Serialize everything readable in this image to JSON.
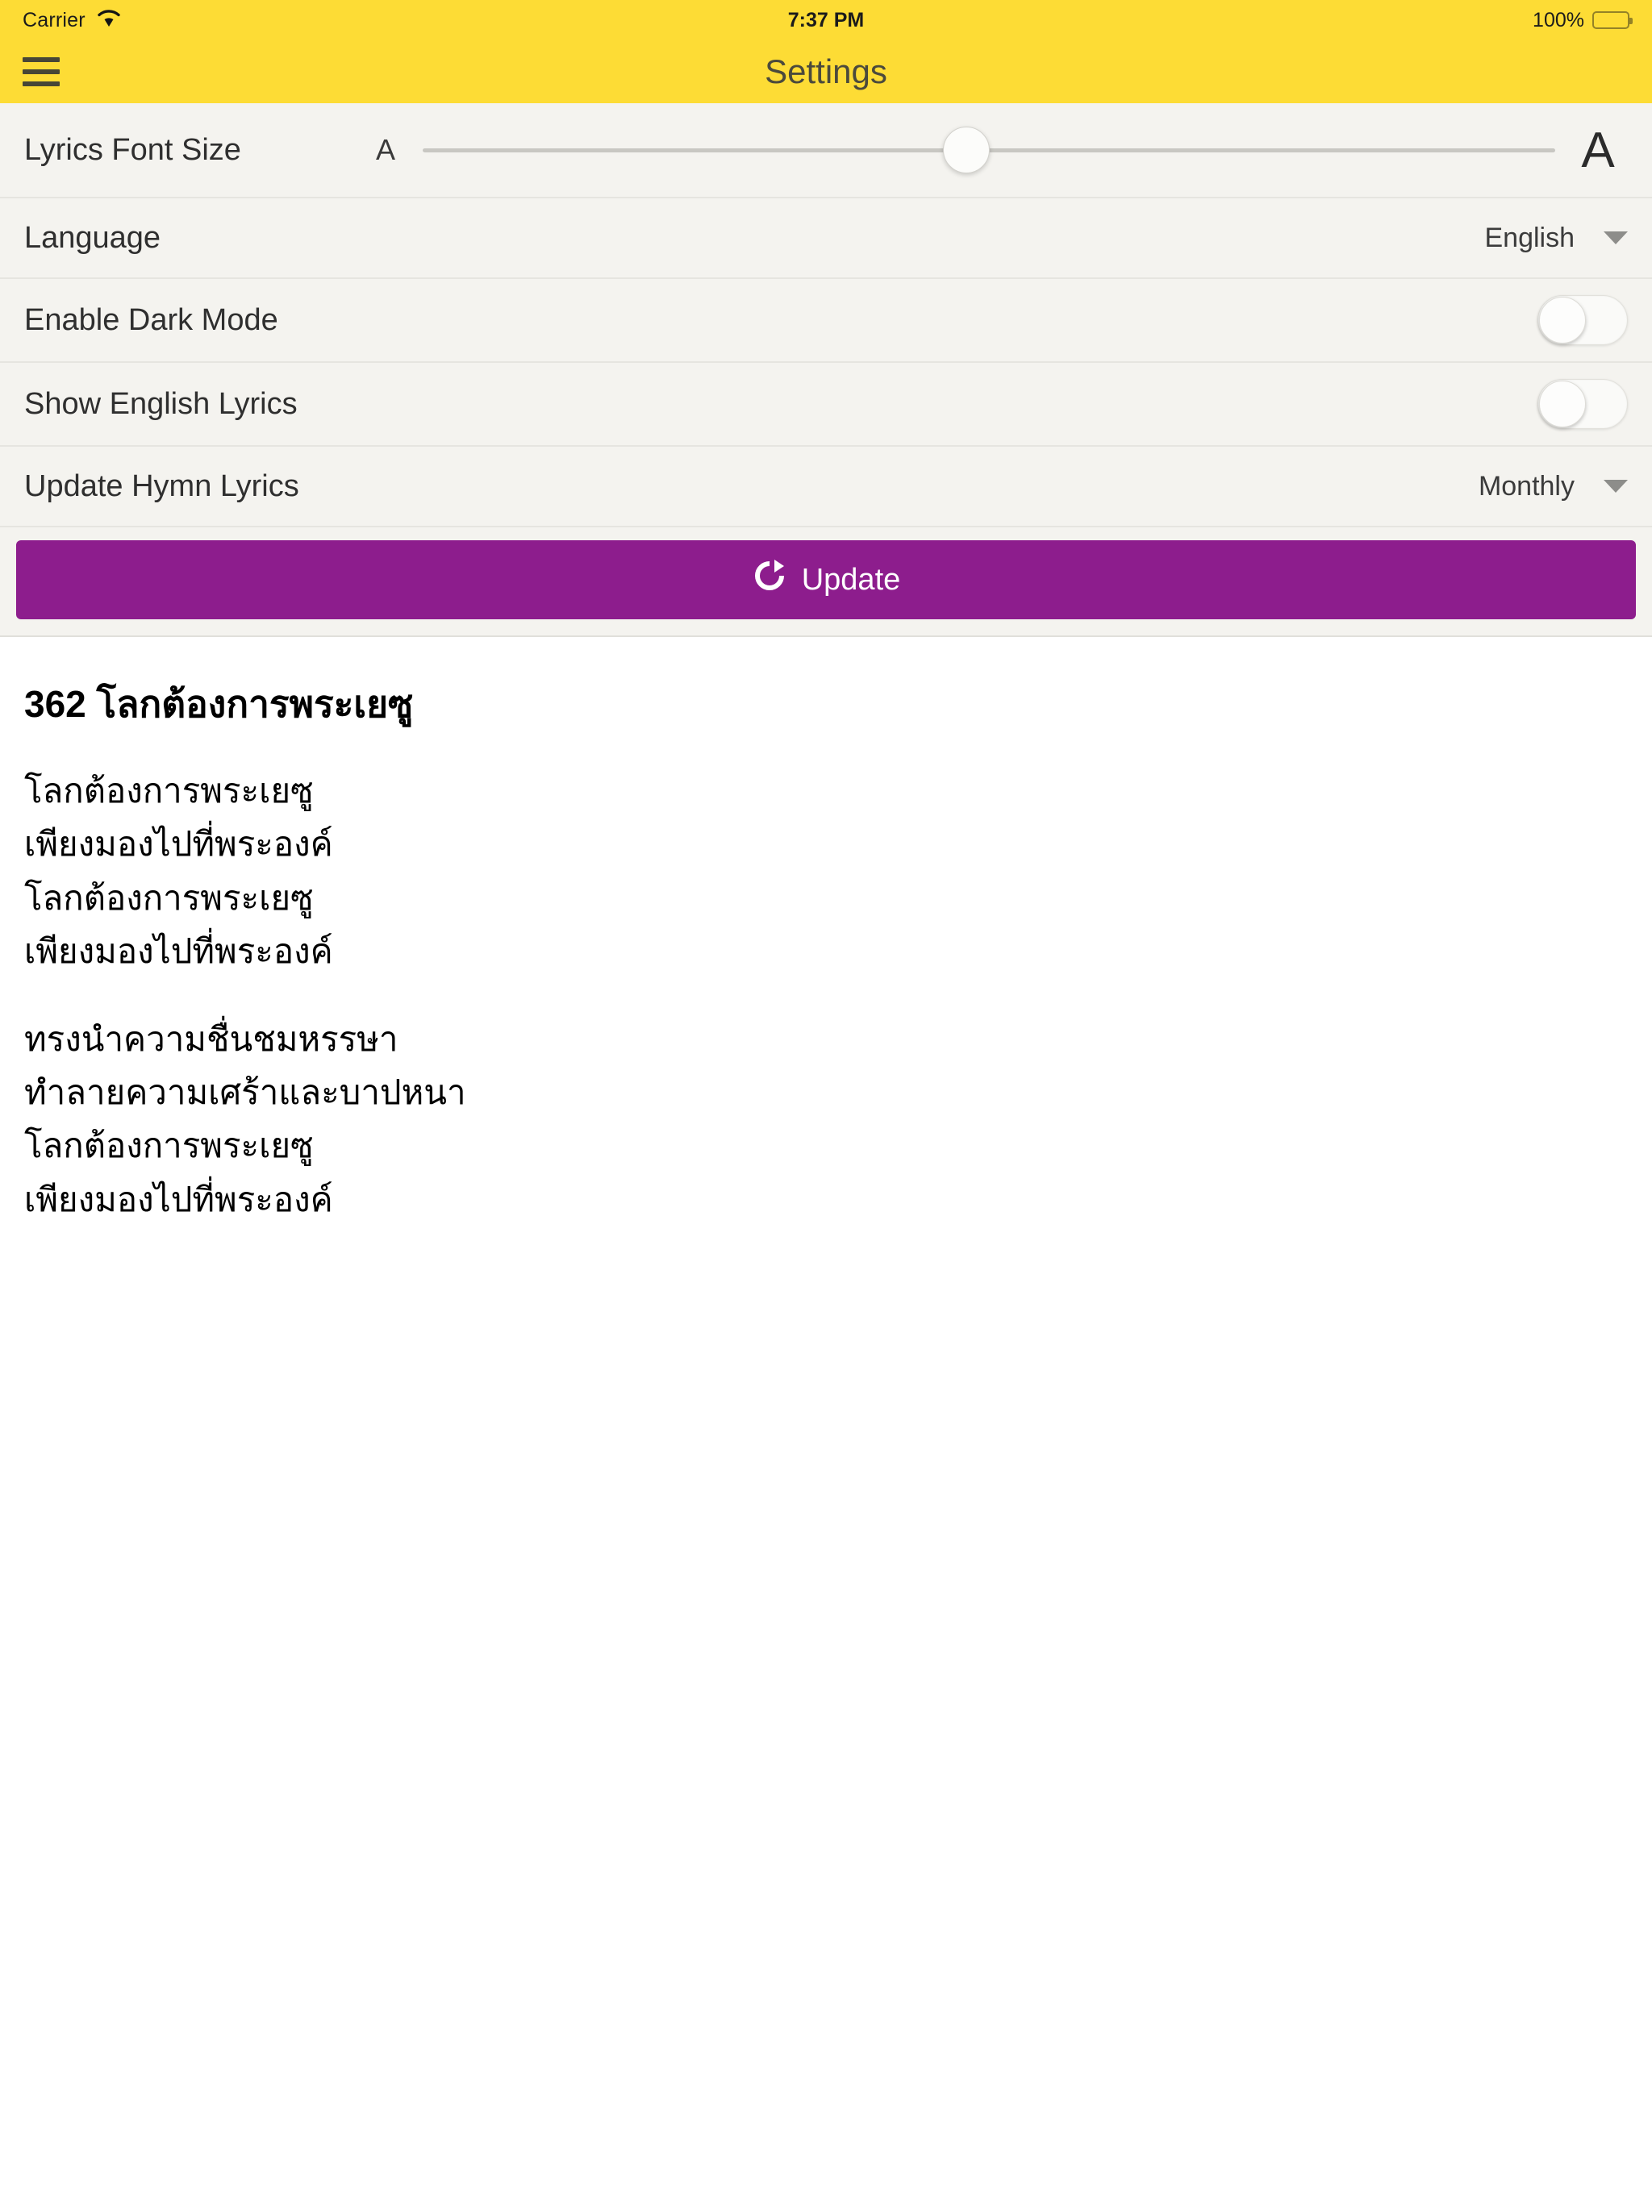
{
  "status_bar": {
    "carrier": "Carrier",
    "wifi_icon": "wifi-icon",
    "time": "7:37 PM",
    "battery_percent": "100%",
    "battery_icon": "battery-full-icon"
  },
  "nav_bar": {
    "menu_icon": "hamburger-menu-icon",
    "title": "Settings"
  },
  "settings": {
    "font_size": {
      "label": "Lyrics Font Size",
      "small_glyph": "A",
      "large_glyph": "A",
      "value_percent": 48
    },
    "language": {
      "label": "Language",
      "value": "English",
      "caret_icon": "chevron-down-icon"
    },
    "dark_mode": {
      "label": "Enable Dark Mode",
      "state": "off"
    },
    "english_lyrics": {
      "label": "Show English Lyrics",
      "state": "off"
    },
    "update_frequency": {
      "label": "Update Hymn Lyrics",
      "value": "Monthly",
      "caret_icon": "chevron-down-icon"
    },
    "update_button": {
      "label": "Update",
      "icon": "refresh-icon",
      "color": "#8D1D8D"
    }
  },
  "hymn": {
    "number": "362",
    "title": "362 โลกต้องการพระเยซู",
    "stanzas": [
      {
        "lines": [
          "โลกต้องการพระเยซู",
          "เพียงมองไปที่พระองค์",
          "โลกต้องการพระเยซู",
          "เพียงมองไปที่พระองค์"
        ]
      },
      {
        "lines": [
          "ทรงนำความชื่นชมหรรษา",
          "ทำลายความเศร้าและบาปหนา",
          "โลกต้องการพระเยซู",
          "เพียงมองไปที่พระองค์"
        ]
      }
    ]
  },
  "theme": {
    "accent_yellow": "#FDDC35",
    "purple": "#8D1D8D",
    "panel_bg": "#F4F3EF",
    "text_dark": "#2f2f2f"
  }
}
